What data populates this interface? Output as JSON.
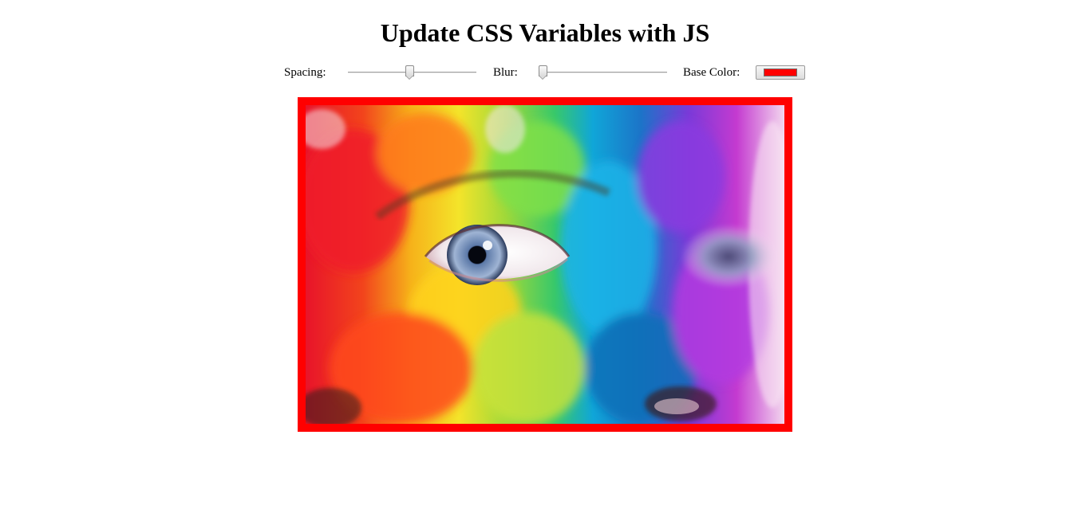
{
  "page": {
    "title": "Update CSS Variables with JS"
  },
  "controls": {
    "spacing": {
      "label": "Spacing:",
      "min": 10,
      "max": 200,
      "value": 100
    },
    "blur": {
      "label": "Blur:",
      "min": 0,
      "max": 25,
      "value": 0
    },
    "base_color": {
      "label": "Base Color:",
      "value": "#ff0000"
    }
  },
  "image": {
    "subject": "close-up of a face painted in rainbow colors with a blue eye",
    "border_color": "#ff0000"
  }
}
